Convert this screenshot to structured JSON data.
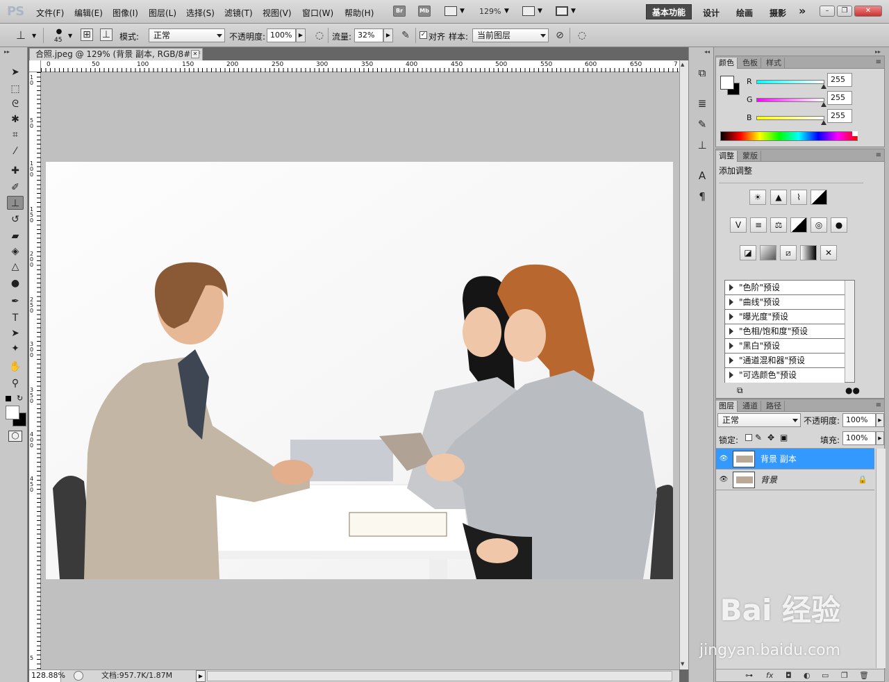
{
  "app": {
    "logo": "PS"
  },
  "menu": [
    "文件(F)",
    "编辑(E)",
    "图像(I)",
    "图层(L)",
    "选择(S)",
    "滤镜(T)",
    "视图(V)",
    "窗口(W)",
    "帮助(H)"
  ],
  "app_bar": {
    "br": "Br",
    "mb": "Mb",
    "zoom": "129%"
  },
  "workspaces": {
    "active": "基本功能",
    "items": [
      "设计",
      "绘画",
      "摄影"
    ],
    "more": "»"
  },
  "window_controls": {
    "minimize": "–",
    "restore": "❐",
    "close": "✕"
  },
  "options": {
    "brush_size": "45",
    "mode_label": "模式:",
    "mode_value": "正常",
    "opacity_label": "不透明度:",
    "opacity_value": "100%",
    "flow_label": "流量:",
    "flow_value": "32%",
    "align_label": "对齐",
    "sample_label": "样本:",
    "sample_value": "当前图层"
  },
  "document": {
    "tab_title": "合照.jpeg @ 129% (背景 副本, RGB/8#) *",
    "close": "✕",
    "ruler_top": [
      "0",
      "50",
      "100",
      "150",
      "200",
      "250",
      "300",
      "350",
      "400",
      "450",
      "500",
      "550",
      "600",
      "650",
      "7"
    ],
    "ruler_left": [
      "1\n0",
      "5\n0",
      "1\n0\n0",
      "1\n5\n0",
      "2\n0\n0",
      "2\n5\n0",
      "3\n0\n0",
      "3\n5\n0",
      "4\n0\n0",
      "4\n5\n0",
      "5"
    ],
    "zoom": "128.88%",
    "doc_info": "文档:957.7K/1.87M"
  },
  "color_panel": {
    "tabs": [
      "颜色",
      "色板",
      "样式"
    ],
    "channels": [
      {
        "label": "R",
        "value": "255",
        "gradient": "linear-gradient(to right,#00ffff,#ffffff)"
      },
      {
        "label": "G",
        "value": "255",
        "gradient": "linear-gradient(to right,#ff00ff,#ffffff)"
      },
      {
        "label": "B",
        "value": "255",
        "gradient": "linear-gradient(to right,#ffff00,#ffffff)"
      }
    ]
  },
  "adjust_panel": {
    "tabs": [
      "调整",
      "蒙版"
    ],
    "title": "添加调整",
    "presets": [
      "\"色阶\"预设",
      "\"曲线\"预设",
      "\"曝光度\"预设",
      "\"色相/饱和度\"预设",
      "\"黑白\"预设",
      "\"通道混和器\"预设",
      "\"可选颜色\"预设"
    ]
  },
  "layers_panel": {
    "tabs": [
      "图层",
      "通道",
      "路径"
    ],
    "blend_mode": "正常",
    "opacity_label": "不透明度:",
    "opacity_value": "100%",
    "lock_label": "锁定:",
    "fill_label": "填充:",
    "fill_value": "100%",
    "layers": [
      {
        "name": "背景 副本",
        "selected": true
      },
      {
        "name": "背景",
        "selected": false,
        "locked": true
      }
    ]
  },
  "watermark": {
    "main": "Bai 经验",
    "sub": "jingyan.baidu.com"
  },
  "colors": {
    "selection": "#3399ff",
    "active_tab": "#4a4a4a"
  }
}
